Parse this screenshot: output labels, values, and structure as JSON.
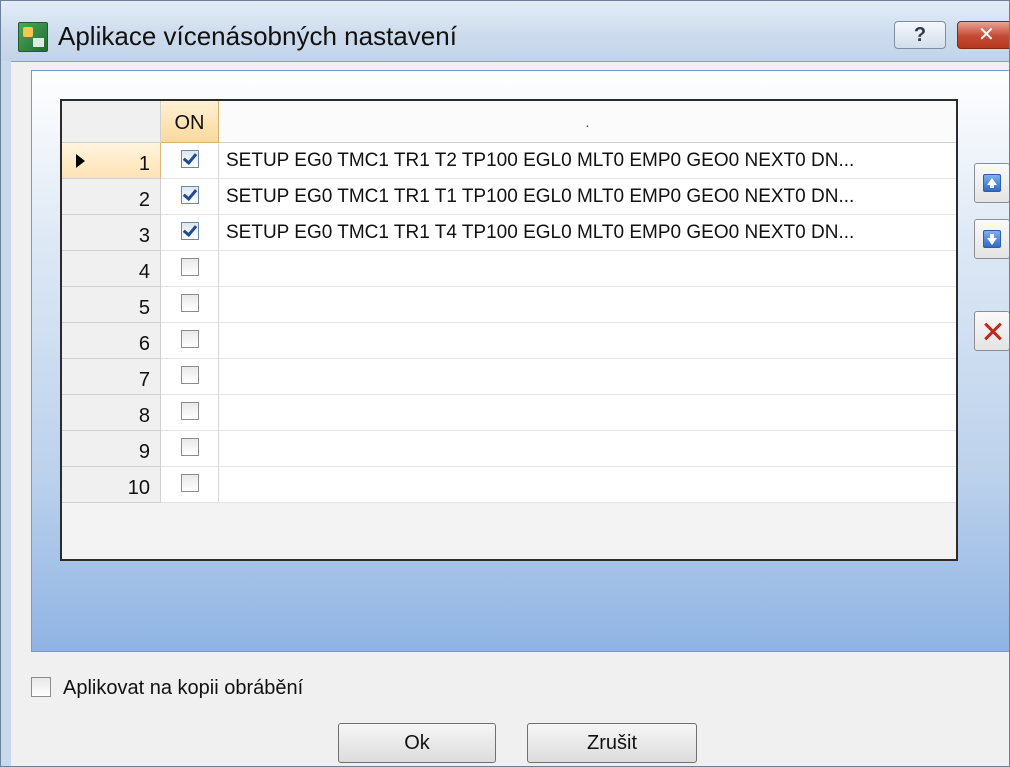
{
  "window": {
    "title": "Aplikace vícenásobných nastavení",
    "help_label": "?",
    "close_label": "✕"
  },
  "grid": {
    "column_on": "ON",
    "column_description": ".",
    "rows": [
      {
        "num": "1",
        "on": true,
        "text": "SETUP EG0 TMC1 TR1 T2 TP100 EGL0 MLT0 EMP0 GEO0 NEXT0 DN...",
        "selected": true
      },
      {
        "num": "2",
        "on": true,
        "text": "SETUP EG0 TMC1 TR1 T1 TP100 EGL0 MLT0 EMP0 GEO0 NEXT0 DN..."
      },
      {
        "num": "3",
        "on": true,
        "text": "SETUP EG0 TMC1 TR1 T4 TP100 EGL0 MLT0 EMP0 GEO0 NEXT0 DN..."
      },
      {
        "num": "4",
        "on": false,
        "text": ""
      },
      {
        "num": "5",
        "on": false,
        "text": ""
      },
      {
        "num": "6",
        "on": false,
        "text": ""
      },
      {
        "num": "7",
        "on": false,
        "text": ""
      },
      {
        "num": "8",
        "on": false,
        "text": ""
      },
      {
        "num": "9",
        "on": false,
        "text": ""
      },
      {
        "num": "10",
        "on": false,
        "text": ""
      }
    ]
  },
  "side_buttons": [
    {
      "name": "move-up-button",
      "icon": "arrow-up-icon"
    },
    {
      "name": "move-down-button",
      "icon": "arrow-down-icon"
    },
    {
      "name": "delete-button",
      "icon": "delete-x-icon"
    }
  ],
  "options": {
    "apply_to_copy_label": "Aplikovat na kopii obrábění",
    "apply_to_copy_checked": false
  },
  "buttons": {
    "ok": "Ok",
    "cancel": "Zrušit"
  }
}
